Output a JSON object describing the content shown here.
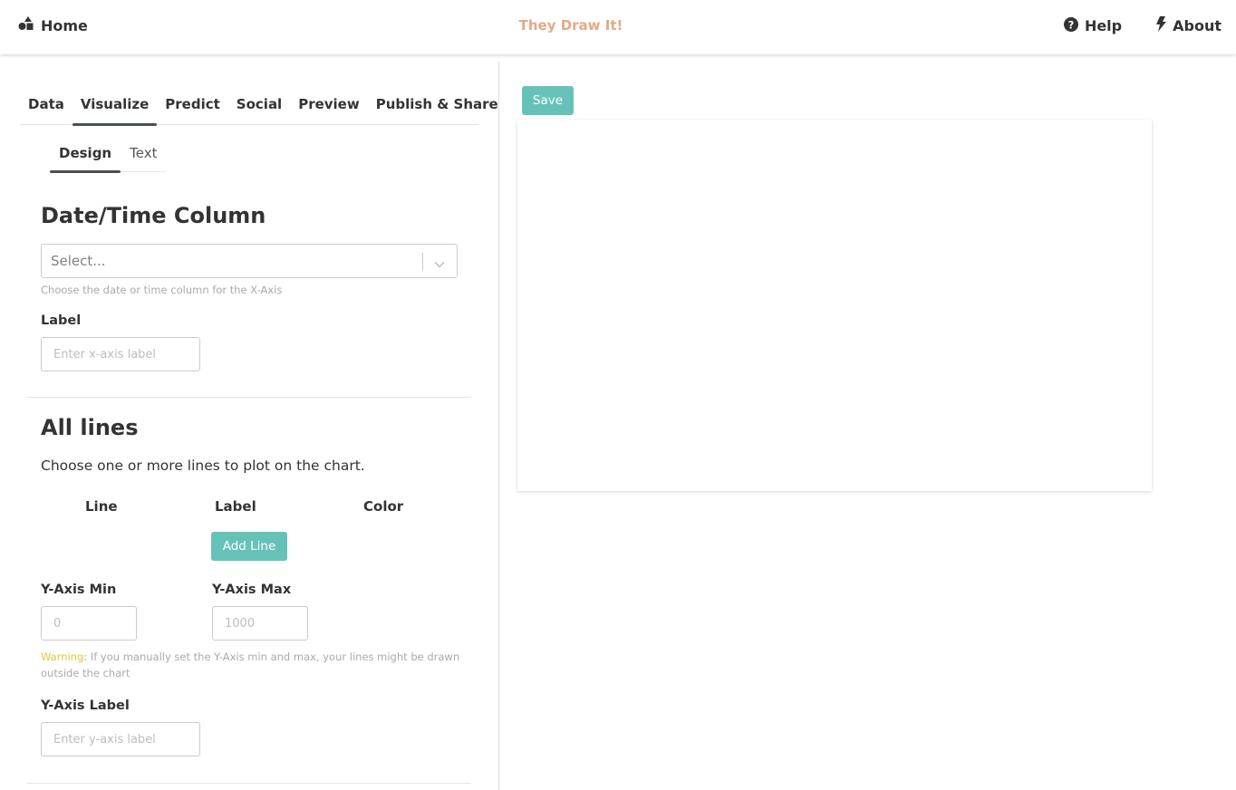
{
  "header": {
    "home_label": "Home",
    "brand": "They Draw It!",
    "help_label": "Help",
    "about_label": "About"
  },
  "tabs": {
    "data": "Data",
    "visualize": "Visualize",
    "predict": "Predict",
    "social": "Social",
    "preview": "Preview",
    "publish": "Publish & Share",
    "active": "Visualize"
  },
  "subtabs": {
    "design": "Design",
    "text": "Text",
    "active": "Design"
  },
  "date_section": {
    "title": "Date/Time Column",
    "select_placeholder": "Select...",
    "select_help": "Choose the date or time column for the X-Axis",
    "label_title": "Label",
    "label_placeholder": "Enter x-axis label"
  },
  "lines_section": {
    "title": "All lines",
    "description": "Choose one or more lines to plot on the chart.",
    "col_line": "Line",
    "col_label": "Label",
    "col_color": "Color",
    "add_button": "Add Line"
  },
  "yaxis": {
    "min_label": "Y-Axis Min",
    "min_placeholder": "0",
    "max_label": "Y-Axis Max",
    "max_placeholder": "1000",
    "warning_prefix": "Warning",
    "warning_text": ": If you manually set the Y-Axis min and max, your lines might be drawn outside the chart",
    "label_title": "Y-Axis Label",
    "label_placeholder": "Enter y-axis label"
  },
  "right": {
    "save_label": "Save"
  },
  "colors": {
    "accent": "#66c2b8",
    "brand": "#e3a988",
    "warning": "#e0c93a"
  },
  "icons": {
    "home": "shapes-icon",
    "help": "question-circle-icon",
    "about": "bolt-icon",
    "select": "chevron-down-icon"
  }
}
